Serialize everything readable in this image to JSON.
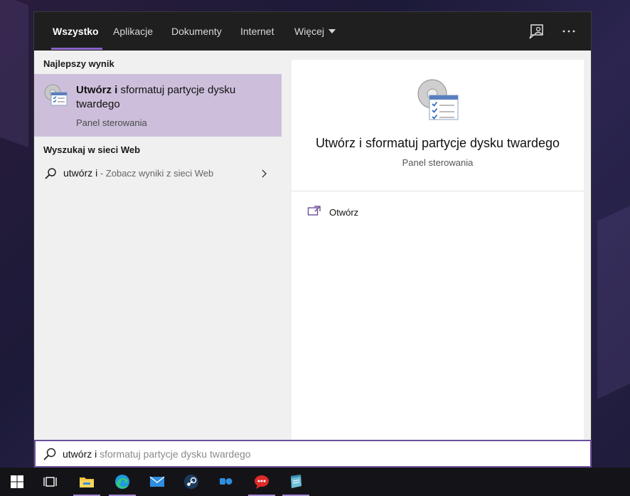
{
  "tabs": [
    {
      "label": "Wszystko",
      "active": true
    },
    {
      "label": "Aplikacje"
    },
    {
      "label": "Dokumenty"
    },
    {
      "label": "Internet"
    },
    {
      "label": "Więcej"
    }
  ],
  "top_icons": [
    "feedback-icon",
    "more-options-icon"
  ],
  "left": {
    "best_heading": "Najlepszy wynik",
    "best_result": {
      "title_bold": "Utwórz i",
      "title_rest": " sformatuj partycje dysku twardego",
      "subtitle": "Panel sterowania",
      "icon": "control-panel-icon"
    },
    "web_heading": "Wyszukaj w sieci Web",
    "web_result": {
      "query": "utwórz i",
      "hint": " - Zobacz wyniki z sieci Web"
    }
  },
  "detail": {
    "title": "Utwórz i sformatuj partycje dysku twardego",
    "subtitle": "Panel sterowania",
    "actions": [
      {
        "label": "Otwórz",
        "icon": "open-icon"
      }
    ]
  },
  "search": {
    "typed": "utwórz i",
    "suggestion": " sformatuj partycje dysku twardego"
  },
  "colors": {
    "accent": "#8b63c7",
    "highlight": "#cdbfdb",
    "tab_bar": "#1f1f1f"
  },
  "taskbar": [
    {
      "icon": "windows-start-icon"
    },
    {
      "icon": "task-view-icon"
    },
    {
      "icon": "file-explorer-icon",
      "active": true
    },
    {
      "icon": "edge-browser-icon",
      "active": true
    },
    {
      "icon": "mail-icon"
    },
    {
      "icon": "steam-icon"
    },
    {
      "icon": "app-bluebird-icon"
    },
    {
      "icon": "chat-app-icon",
      "active": true
    },
    {
      "icon": "notepad-app-icon",
      "active": true
    }
  ]
}
